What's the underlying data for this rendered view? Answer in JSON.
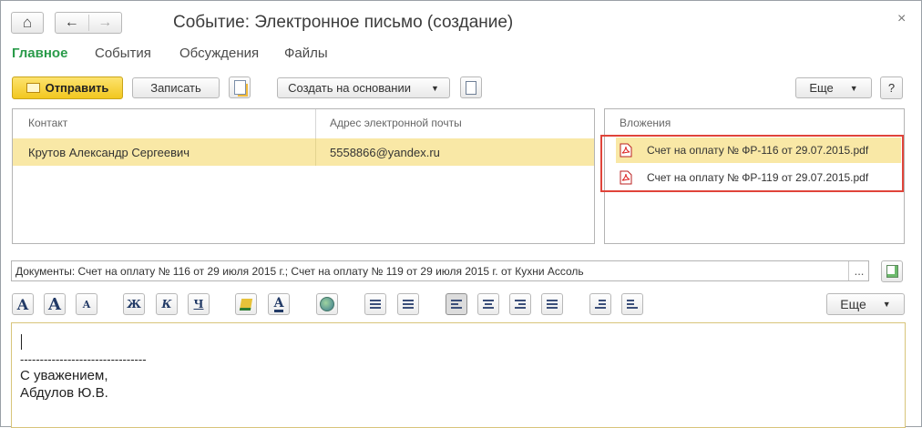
{
  "window": {
    "title": "Событие: Электронное письмо (создание)",
    "close_glyph": "×"
  },
  "nav": {
    "home_glyph": "⌂",
    "back_glyph": "←",
    "forward_glyph": "→"
  },
  "tabs": [
    {
      "label": "Главное",
      "active": true
    },
    {
      "label": "События",
      "active": false
    },
    {
      "label": "Обсуждения",
      "active": false
    },
    {
      "label": "Файлы",
      "active": false
    }
  ],
  "toolbar": {
    "send_label": "Отправить",
    "save_label": "Записать",
    "create_based_label": "Создать на основании",
    "more_label": "Еще",
    "help_label": "?"
  },
  "recipients": {
    "headers": [
      "Контакт",
      "Адрес электронной почты"
    ],
    "rows": [
      {
        "contact": "Крутов Александр Сергеевич",
        "email": "5558866@yandex.ru",
        "selected": true
      }
    ]
  },
  "attachments": {
    "header": "Вложения",
    "items": [
      {
        "name": "Счет на оплату № ФР-116 от 29.07.2015.pdf"
      },
      {
        "name": "Счет на оплату № ФР-119 от 29.07.2015.pdf"
      }
    ]
  },
  "documents_field": {
    "value": "Документы: Счет на оплату № 116 от 29 июля 2015 г.; Счет на оплату № 119 от 29 июля 2015 г. от Кухни Ассоль",
    "select_label": "..."
  },
  "format_toolbar": {
    "font_label": "A",
    "bold_label": "Ж",
    "italic_label": "К",
    "underline_label": "Ч",
    "more_label": "Еще"
  },
  "editor": {
    "separator": "--------------------------------",
    "lines": [
      "С уважением,",
      "Абдулов Ю.В."
    ]
  },
  "colors": {
    "accent_green": "#2a9b4a",
    "send_yellow": "#f6d23a",
    "selection": "#f9e8a6",
    "highlight_red": "#e0443a"
  }
}
